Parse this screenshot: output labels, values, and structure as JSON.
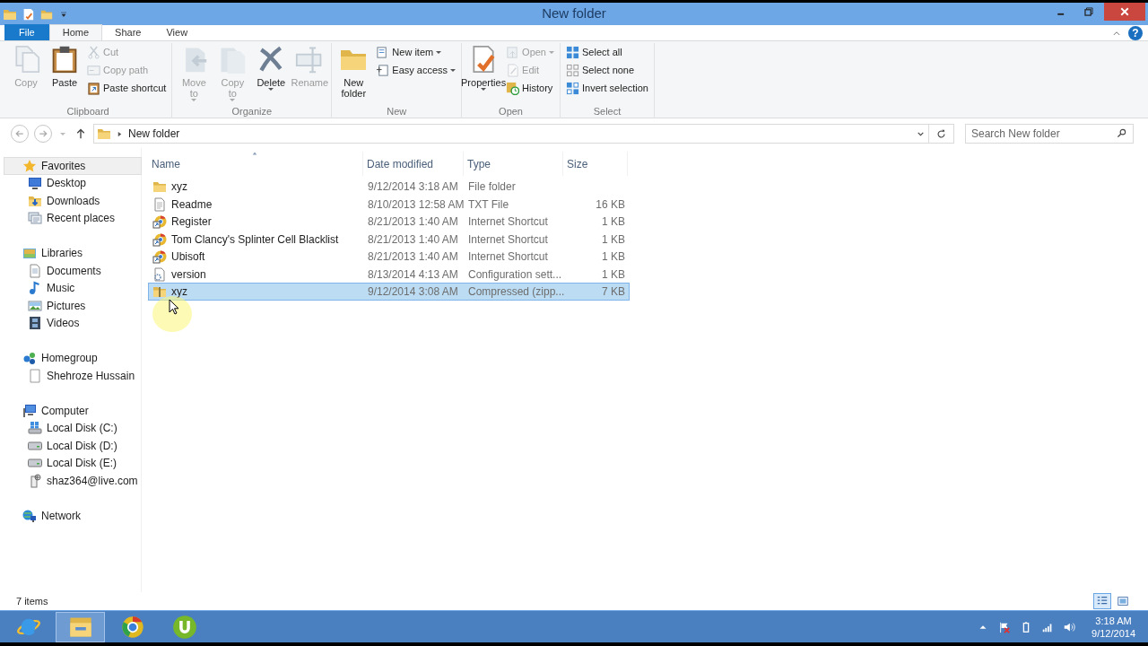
{
  "window": {
    "title": "New folder"
  },
  "ribbon_tabs": [
    {
      "label": "File",
      "kind": "file",
      "selected": false
    },
    {
      "label": "Home",
      "kind": "tab",
      "selected": true
    },
    {
      "label": "Share",
      "kind": "tab",
      "selected": false
    },
    {
      "label": "View",
      "kind": "tab",
      "selected": false
    }
  ],
  "help": "?",
  "ribbon_groups": [
    {
      "label": "Clipboard",
      "buttons": [
        {
          "label": "Copy",
          "kind": "large",
          "disabled": true,
          "dropdown": false
        },
        {
          "label": "Paste",
          "kind": "large",
          "disabled": false,
          "dropdown": false
        },
        {
          "label": "Cut",
          "kind": "small",
          "disabled": true,
          "dropdown": false
        },
        {
          "label": "Copy path",
          "kind": "small",
          "disabled": true,
          "dropdown": false
        },
        {
          "label": "Paste shortcut",
          "kind": "small",
          "disabled": false,
          "dropdown": false
        }
      ]
    },
    {
      "label": "Organize",
      "buttons": [
        {
          "label": "Move to",
          "kind": "large",
          "disabled": true,
          "dropdown": true
        },
        {
          "label": "Copy to",
          "kind": "large",
          "disabled": true,
          "dropdown": true
        },
        {
          "label": "Delete",
          "kind": "large",
          "disabled": false,
          "dropdown": true
        },
        {
          "label": "Rename",
          "kind": "large",
          "disabled": true,
          "dropdown": false
        }
      ]
    },
    {
      "label": "New",
      "buttons": [
        {
          "label": "New folder",
          "kind": "large",
          "disabled": false,
          "dropdown": false
        },
        {
          "label": "New item",
          "kind": "small",
          "disabled": false,
          "dropdown": true
        },
        {
          "label": "Easy access",
          "kind": "small",
          "disabled": false,
          "dropdown": true
        }
      ]
    },
    {
      "label": "Open",
      "buttons": [
        {
          "label": "Properties",
          "kind": "large",
          "disabled": false,
          "dropdown": true
        },
        {
          "label": "Open",
          "kind": "small",
          "disabled": true,
          "dropdown": true
        },
        {
          "label": "Edit",
          "kind": "small",
          "disabled": true,
          "dropdown": false
        },
        {
          "label": "History",
          "kind": "small",
          "disabled": false,
          "dropdown": false
        }
      ]
    },
    {
      "label": "Select",
      "buttons": [
        {
          "label": "Select all",
          "kind": "small",
          "disabled": false,
          "dropdown": false
        },
        {
          "label": "Select none",
          "kind": "small",
          "disabled": false,
          "dropdown": false
        },
        {
          "label": "Invert selection",
          "kind": "small",
          "disabled": false,
          "dropdown": false
        }
      ]
    }
  ],
  "address": {
    "path": [
      "New folder"
    ],
    "search_placeholder": "Search New folder"
  },
  "navigation": [
    {
      "label": "Favorites",
      "kind": "favorites",
      "selected": true,
      "children": [
        {
          "label": "Desktop",
          "kind": "desktop",
          "selected": false
        },
        {
          "label": "Downloads",
          "kind": "downloads",
          "selected": false
        },
        {
          "label": "Recent places",
          "kind": "recent",
          "selected": false
        }
      ]
    },
    {
      "label": "Libraries",
      "kind": "libraries",
      "selected": false,
      "children": [
        {
          "label": "Documents",
          "kind": "documents",
          "selected": false
        },
        {
          "label": "Music",
          "kind": "music",
          "selected": false
        },
        {
          "label": "Pictures",
          "kind": "pictures",
          "selected": false
        },
        {
          "label": "Videos",
          "kind": "videos",
          "selected": false
        }
      ]
    },
    {
      "label": "Homegroup",
      "kind": "homegroup",
      "selected": false,
      "children": [
        {
          "label": "Shehroze Hussain",
          "kind": "user",
          "selected": false
        }
      ]
    },
    {
      "label": "Computer",
      "kind": "computer",
      "selected": false,
      "children": [
        {
          "label": "Local Disk (C:)",
          "kind": "systemdisk",
          "selected": false
        },
        {
          "label": "Local Disk (D:)",
          "kind": "disk",
          "selected": false
        },
        {
          "label": "Local Disk (E:)",
          "kind": "disk",
          "selected": false
        },
        {
          "label": "shaz364@live.com",
          "kind": "phone",
          "selected": false
        }
      ]
    },
    {
      "label": "Network",
      "kind": "network",
      "selected": false
    }
  ],
  "table": {
    "columns": [
      {
        "label": "Name",
        "sorted": true
      },
      {
        "label": "Date modified",
        "sorted": false
      },
      {
        "label": "Type",
        "sorted": false
      },
      {
        "label": "Size",
        "sorted": false
      }
    ],
    "rows": [
      {
        "name": "xyz",
        "date": "9/12/2014 3:18 AM",
        "type": "File folder",
        "size": "",
        "kind": "folder",
        "selected": false
      },
      {
        "name": "Readme",
        "date": "8/10/2013 12:58 AM",
        "type": "TXT File",
        "size": "16 KB",
        "kind": "text",
        "selected": false
      },
      {
        "name": "Register",
        "date": "8/21/2013 1:40 AM",
        "type": "Internet Shortcut",
        "size": "1 KB",
        "kind": "shortcut",
        "selected": false
      },
      {
        "name": "Tom Clancy's Splinter Cell Blacklist",
        "date": "8/21/2013 1:40 AM",
        "type": "Internet Shortcut",
        "size": "1 KB",
        "kind": "shortcut",
        "selected": false
      },
      {
        "name": "Ubisoft",
        "date": "8/21/2013 1:40 AM",
        "type": "Internet Shortcut",
        "size": "1 KB",
        "kind": "shortcut",
        "selected": false
      },
      {
        "name": "version",
        "date": "8/13/2014 4:13 AM",
        "type": "Configuration sett...",
        "size": "1 KB",
        "kind": "config",
        "selected": false
      },
      {
        "name": "xyz",
        "date": "9/12/2014 3:08 AM",
        "type": "Compressed (zipp...",
        "size": "7 KB",
        "kind": "zip",
        "selected": true
      }
    ]
  },
  "status_bar": {
    "item_count": "7 items",
    "views": [
      {
        "kind": "details",
        "selected": true
      },
      {
        "kind": "large_icons",
        "selected": false
      }
    ]
  },
  "taskbar": {
    "apps": [
      {
        "kind": "browser_e",
        "selected": false
      },
      {
        "kind": "explorer",
        "selected": true
      },
      {
        "kind": "browser_ring",
        "selected": false
      },
      {
        "kind": "torrent",
        "selected": false
      }
    ],
    "time": "3:18 AM",
    "date": "9/12/2014"
  }
}
